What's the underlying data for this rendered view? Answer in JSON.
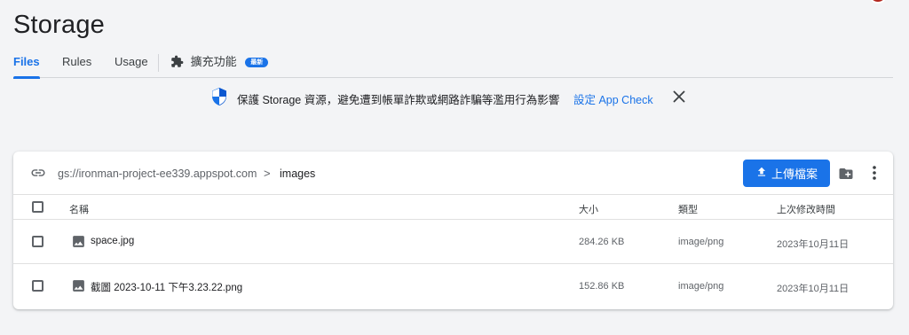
{
  "page": {
    "title": "Storage"
  },
  "tabs": [
    {
      "label": "Files",
      "active": true
    },
    {
      "label": "Rules",
      "active": false
    },
    {
      "label": "Usage",
      "active": false
    },
    {
      "label": "擴充功能",
      "badge": "最新",
      "active": false
    }
  ],
  "banner": {
    "text": "保護 Storage 資源，避免遭到帳單詐欺或網路詐騙等濫用行為影響",
    "link": "設定 App Check"
  },
  "browser": {
    "bucket": "gs://ironman-project-ee339.appspot.com",
    "separator": ">",
    "folder": "images",
    "upload_label": "上傳檔案",
    "columns": {
      "name": "名稱",
      "size": "大小",
      "type": "類型",
      "modified": "上次修改時間"
    },
    "rows": [
      {
        "name": "space.jpg",
        "size": "284.26 KB",
        "type": "image/png",
        "modified": "2023年10月11日"
      },
      {
        "name": "截圖 2023-10-11 下午3.23.22.png",
        "size": "152.86 KB",
        "type": "image/png",
        "modified": "2023年10月11日"
      }
    ]
  },
  "icons": {
    "shield": "shield-icon",
    "close": "close-icon",
    "link": "link-icon",
    "upload": "upload-icon",
    "new_folder": "create-folder-icon",
    "more": "more-vert-icon",
    "image": "image-file-icon",
    "extensions": "extensions-icon"
  },
  "colors": {
    "accent": "#1a73e8",
    "text": "#202124",
    "muted": "#5f6368",
    "background": "#f3f4f6"
  }
}
